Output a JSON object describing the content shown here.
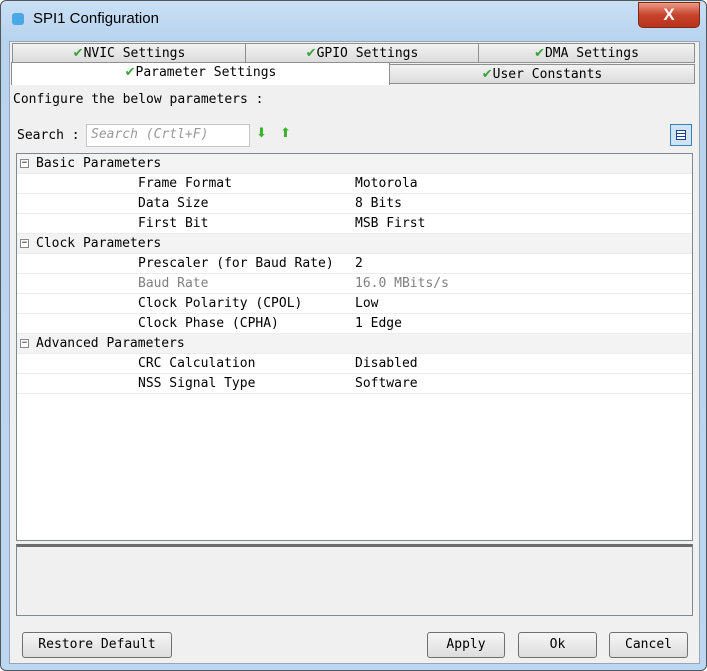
{
  "window": {
    "title": "SPI1 Configuration",
    "close": "X"
  },
  "tabs": {
    "row1": [
      "NVIC Settings",
      "GPIO Settings",
      "DMA Settings"
    ],
    "row2": [
      "Parameter Settings",
      "User Constants"
    ]
  },
  "check": "✔",
  "intro": "Configure the below parameters :",
  "search": {
    "label": "Search :",
    "placeholder": "Search (Crtl+F)",
    "down": "⬇",
    "up": "⬆"
  },
  "groups": [
    {
      "name": "Basic Parameters",
      "params": [
        [
          "Frame Format",
          "Motorola"
        ],
        [
          "Data Size",
          "8 Bits"
        ],
        [
          "First Bit",
          "MSB First"
        ]
      ]
    },
    {
      "name": "Clock Parameters",
      "params": [
        [
          "Prescaler (for Baud Rate)",
          "2"
        ],
        [
          "Baud Rate",
          "16.0 MBits/s"
        ],
        [
          "Clock Polarity (CPOL)",
          "Low"
        ],
        [
          "Clock Phase (CPHA)",
          "1 Edge"
        ]
      ]
    },
    {
      "name": "Advanced Parameters",
      "params": [
        [
          "CRC Calculation",
          "Disabled"
        ],
        [
          "NSS Signal Type",
          "Software"
        ]
      ]
    }
  ],
  "buttons": {
    "restore": "Restore Default",
    "apply": "Apply",
    "ok": "Ok",
    "cancel": "Cancel"
  }
}
